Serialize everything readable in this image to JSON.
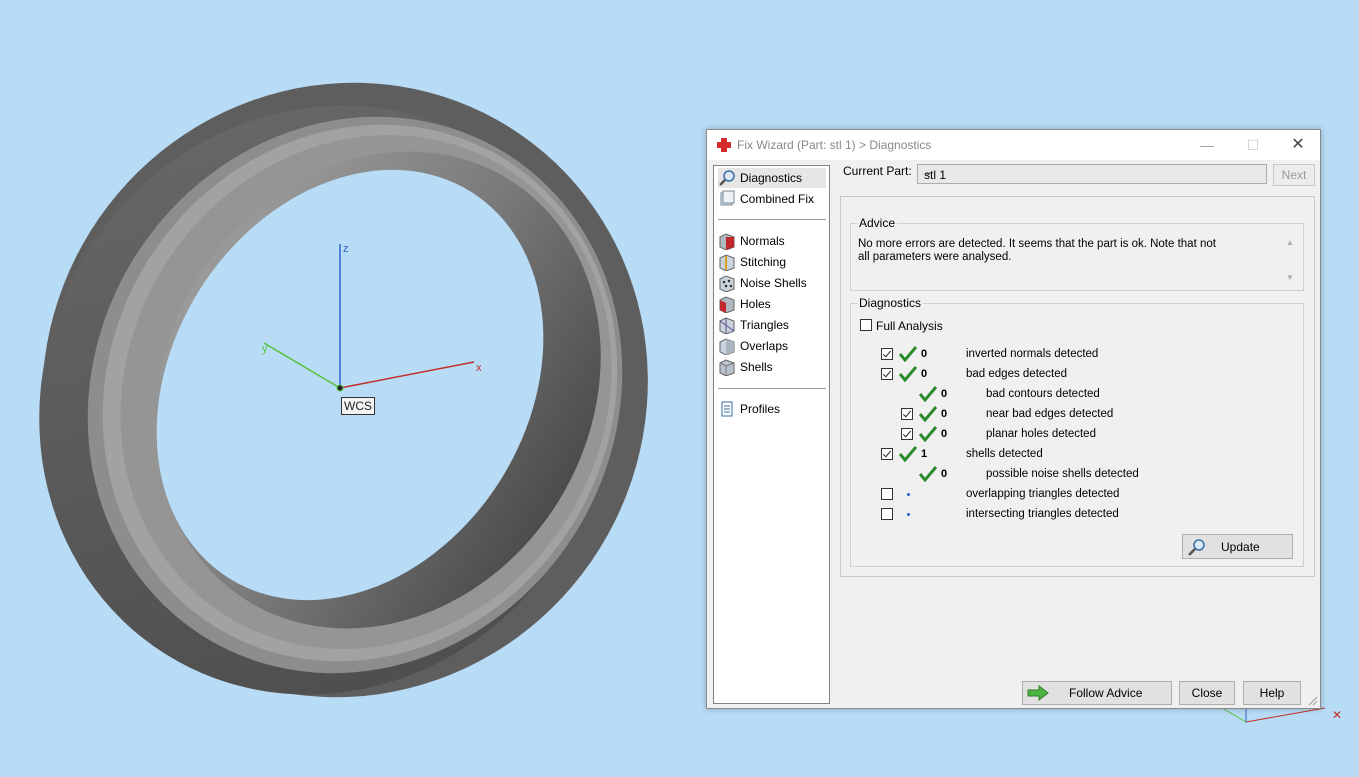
{
  "viewport": {
    "axis_labels": {
      "z": "z",
      "y": "y",
      "x": "x"
    },
    "wcs_label": "WCS",
    "colors": {
      "background": "#b9dcf6",
      "x_axis": "#c0302b",
      "y_axis": "#55c23a",
      "z_axis": "#2c62c9"
    }
  },
  "dialog": {
    "title": "Fix Wizard (Part: stl 1) > Diagnostics",
    "window_buttons": {
      "minimize": "—",
      "maximize": "☐",
      "close": "✕"
    },
    "nav": {
      "items": [
        {
          "label": "Diagnostics",
          "icon": "magnifier-icon",
          "selected": true
        },
        {
          "label": "Combined Fix",
          "icon": "combined-fix-icon"
        },
        {
          "label": "Normals",
          "icon": "normals-icon"
        },
        {
          "label": "Stitching",
          "icon": "stitching-icon"
        },
        {
          "label": "Noise Shells",
          "icon": "noise-shells-icon"
        },
        {
          "label": "Holes",
          "icon": "holes-icon"
        },
        {
          "label": "Triangles",
          "icon": "triangles-icon"
        },
        {
          "label": "Overlaps",
          "icon": "overlaps-icon"
        },
        {
          "label": "Shells",
          "icon": "shells-icon"
        },
        {
          "label": "Profiles",
          "icon": "profiles-icon"
        }
      ]
    },
    "current_part_label": "Current Part:",
    "current_part_value": "stl 1",
    "next_label": "Next",
    "advice": {
      "title": "Advice",
      "text": "No more errors are detected. It seems that the part is ok. Note that not all parameters were analysed."
    },
    "diagnostics": {
      "title": "Diagnostics",
      "full_analysis_label": "Full Analysis",
      "full_analysis_checked": false,
      "rows": [
        {
          "text": "inverted normals detected",
          "count": "0",
          "checkbox": true,
          "checked": true,
          "status": "ok"
        },
        {
          "text": "bad edges detected",
          "count": "0",
          "checkbox": true,
          "checked": true,
          "status": "ok"
        },
        {
          "text": "bad contours detected",
          "count": "0",
          "checkbox": false,
          "checked": false,
          "status": "ok"
        },
        {
          "text": "near bad edges detected",
          "count": "0",
          "checkbox": true,
          "checked": true,
          "status": "ok"
        },
        {
          "text": "planar holes detected",
          "count": "0",
          "checkbox": true,
          "checked": true,
          "status": "ok"
        },
        {
          "text": "shells detected",
          "count": "1",
          "checkbox": true,
          "checked": true,
          "status": "ok"
        },
        {
          "text": "possible noise shells detected",
          "count": "0",
          "checkbox": false,
          "checked": false,
          "status": "ok"
        },
        {
          "text": "overlapping triangles detected",
          "count": "",
          "checkbox": true,
          "checked": false,
          "status": "pending"
        },
        {
          "text": "intersecting triangles detected",
          "count": "",
          "checkbox": true,
          "checked": false,
          "status": "pending"
        }
      ],
      "update_label": "Update"
    },
    "follow_advice_label": "Follow Advice",
    "close_label": "Close",
    "help_label": "Help"
  }
}
